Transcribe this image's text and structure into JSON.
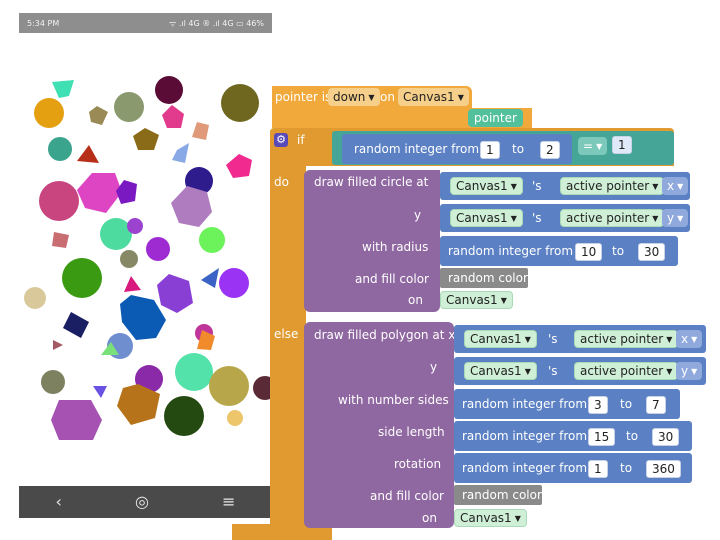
{
  "phone": {
    "status": {
      "time": "5:34 PM",
      "signal": "ᯤ .ıl 4G ® .ıl 4G",
      "battery": "46%"
    },
    "nav": {
      "back": "‹",
      "home": "◎",
      "menu": "≡"
    }
  },
  "event": {
    "prefix": "pointer is",
    "event_name": "down",
    "on_label": "on",
    "component": "Canvas1",
    "param": "pointer"
  },
  "if_block": {
    "if_label": "if",
    "do_label": "do",
    "else_label": "else",
    "condition": {
      "random_label": "random integer from",
      "from": "1",
      "to_label": "to",
      "to": "2",
      "op": "=",
      "compare": "1"
    }
  },
  "circle": {
    "title": "draw filled circle at x",
    "x": {
      "component": "Canvas1",
      "apos": "'s",
      "prop": "active pointer",
      "field": "x"
    },
    "y_label": "y",
    "y": {
      "component": "Canvas1",
      "apos": "'s",
      "prop": "active pointer",
      "field": "y"
    },
    "radius_label": "with radius",
    "radius": {
      "random_label": "random integer from",
      "from": "10",
      "to_label": "to",
      "to": "30"
    },
    "fill_label": "and fill color",
    "fill": "random color",
    "on_label": "on",
    "on": "Canvas1"
  },
  "polygon": {
    "title": "draw filled polygon at x",
    "x": {
      "component": "Canvas1",
      "apos": "'s",
      "prop": "active pointer",
      "field": "x"
    },
    "y_label": "y",
    "y": {
      "component": "Canvas1",
      "apos": "'s",
      "prop": "active pointer",
      "field": "y"
    },
    "sides_label": "with number sides",
    "sides": {
      "random_label": "random integer from",
      "from": "3",
      "to_label": "to",
      "to": "7"
    },
    "length_label": "side length",
    "length": {
      "random_label": "random integer from",
      "from": "15",
      "to_label": "to",
      "to": "30"
    },
    "rotation_label": "rotation",
    "rotation": {
      "random_label": "random integer from",
      "from": "1",
      "to_label": "to",
      "to": "360"
    },
    "fill_label": "and fill color",
    "fill": "random color",
    "on_label": "on",
    "on": "Canvas1"
  },
  "colors": {
    "event": "#f1a93c",
    "control": "#f1a93c",
    "logic": "#45a698",
    "procedure": "#8f67a1",
    "math": "#5b80c4",
    "color": "#8a8a8a"
  },
  "icons": {
    "gear": "gear-icon",
    "dropdown": "chevron-down-icon"
  }
}
